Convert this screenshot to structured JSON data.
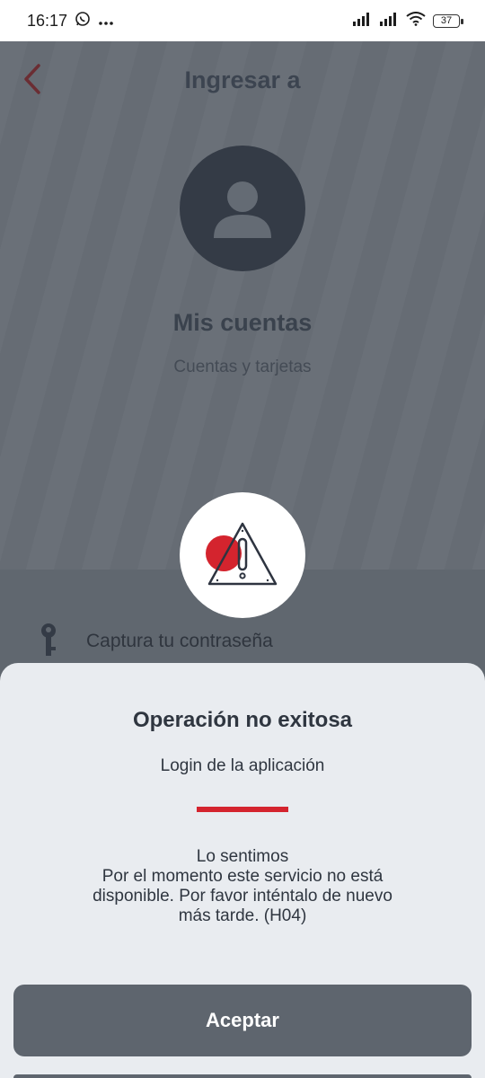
{
  "status_bar": {
    "time": "16:17",
    "battery": "37",
    "icons": [
      "whatsapp-icon",
      "more-dots-icon",
      "signal-icon",
      "signal-icon",
      "wifi-icon",
      "battery-icon"
    ]
  },
  "header": {
    "title": "Ingresar a",
    "back_icon": "chevron-left-icon"
  },
  "account": {
    "title": "Mis cuentas",
    "subtitle": "Cuentas y tarjetas",
    "avatar_icon": "user-icon"
  },
  "password": {
    "label": "Captura tu contraseña",
    "icon": "key-icon"
  },
  "dialog": {
    "icon": "warning-icon",
    "title": "Operación no exitosa",
    "subtitle": "Login de la aplicación",
    "message_lines": [
      "Lo sentimos",
      "Por el momento este servicio no está",
      "disponible. Por favor inténtalo de nuevo",
      "más tarde. (H04)"
    ],
    "accept_label": "Aceptar"
  },
  "colors": {
    "accent_red": "#d4242e",
    "overlay": "#5f666f",
    "sheet_bg": "#e9ecf0",
    "button_bg": "#5e656e",
    "text_dark": "#2f3640"
  }
}
